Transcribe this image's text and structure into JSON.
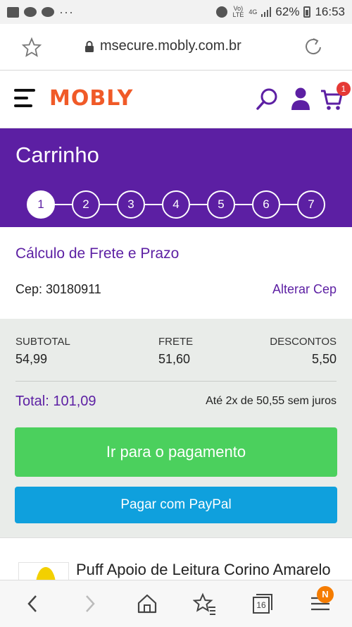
{
  "status_bar": {
    "battery": "62%",
    "time": "16:53",
    "volte": "Vo) LTE",
    "network": "4G",
    "dots": "···"
  },
  "browser": {
    "url": "msecure.mobly.com.br",
    "icons": [
      "star-icon",
      "lock-icon",
      "reload-icon"
    ]
  },
  "header": {
    "logo": "MOBLY",
    "cart_count": "1",
    "icons": [
      "menu-icon",
      "search-icon",
      "user-icon",
      "cart-icon"
    ],
    "accent_color": "#f05a28"
  },
  "cart": {
    "title": "Carrinho",
    "steps": [
      "1",
      "2",
      "3",
      "4",
      "5",
      "6",
      "7"
    ],
    "active_step": "1",
    "band_color": "#5c1fa3"
  },
  "shipping": {
    "title": "Cálculo de Frete e Prazo",
    "cep_label": "Cep: 30180911",
    "change_label": "Alterar Cep"
  },
  "summary": {
    "subtotal_label": "SUBTOTAL",
    "subtotal_value": "54,99",
    "frete_label": "FRETE",
    "frete_value": "51,60",
    "descontos_label": "DESCONTOS",
    "descontos_value": "5,50",
    "total": "Total: 101,09",
    "installments": "Até 2x de 50,55 sem juros"
  },
  "actions": {
    "pay_label": "Ir para o pagamento",
    "pay_color": "#4bd05d",
    "paypal_label": "Pagar com PayPal",
    "paypal_color": "#0fa0dd"
  },
  "product": {
    "name": "Puff Apoio de Leitura Corino Amarelo"
  },
  "bottom_nav": {
    "tabs_count": "16",
    "badge": "N",
    "icons": [
      "back-icon",
      "forward-icon",
      "home-icon",
      "bookmarks-icon",
      "tabs-icon",
      "menu-icon"
    ]
  }
}
